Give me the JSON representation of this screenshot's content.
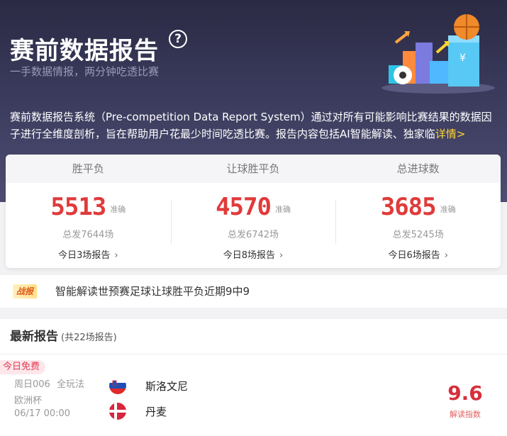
{
  "hero": {
    "title": "赛前数据报告",
    "help_icon": "question-circle-icon",
    "subtitle": "一手数据情报，两分钟吃透比赛",
    "description": "赛前数据报告系统（Pre-competition Data Report System）通过对所有可能影响比赛结果的数据因子进行全维度剖析，旨在帮助用户花最少时间吃透比赛。报告内容包括AI智能解读、独家临",
    "more_link": "详情>"
  },
  "stats": {
    "headers": [
      "胜平负",
      "让球胜平负",
      "总进球数"
    ],
    "columns": [
      {
        "value": "5513",
        "tag": "准确",
        "total": "总发7644场",
        "today": "今日3场报告"
      },
      {
        "value": "4570",
        "tag": "准确",
        "total": "总发6742场",
        "today": "今日8场报告"
      },
      {
        "value": "3685",
        "tag": "准确",
        "total": "总发5245场",
        "today": "今日6场报告"
      }
    ]
  },
  "battle": {
    "badge": "战报",
    "text": "智能解读世预赛足球让球胜平负近期9中9"
  },
  "latest": {
    "title": "最新报告",
    "count": "(共22场报告)",
    "match": {
      "free_badge": "今日免费",
      "code": "周日006",
      "play": "全玩法",
      "league": "欧洲杯",
      "time": "06/17 00:00",
      "home": "斯洛文尼",
      "away": "丹麦",
      "index_value": "9.6",
      "index_label": "解读指数"
    }
  },
  "colors": {
    "accent_red": "#e03a3a",
    "link_yellow": "#ffd633",
    "hero_bg": "#2a2a44"
  }
}
